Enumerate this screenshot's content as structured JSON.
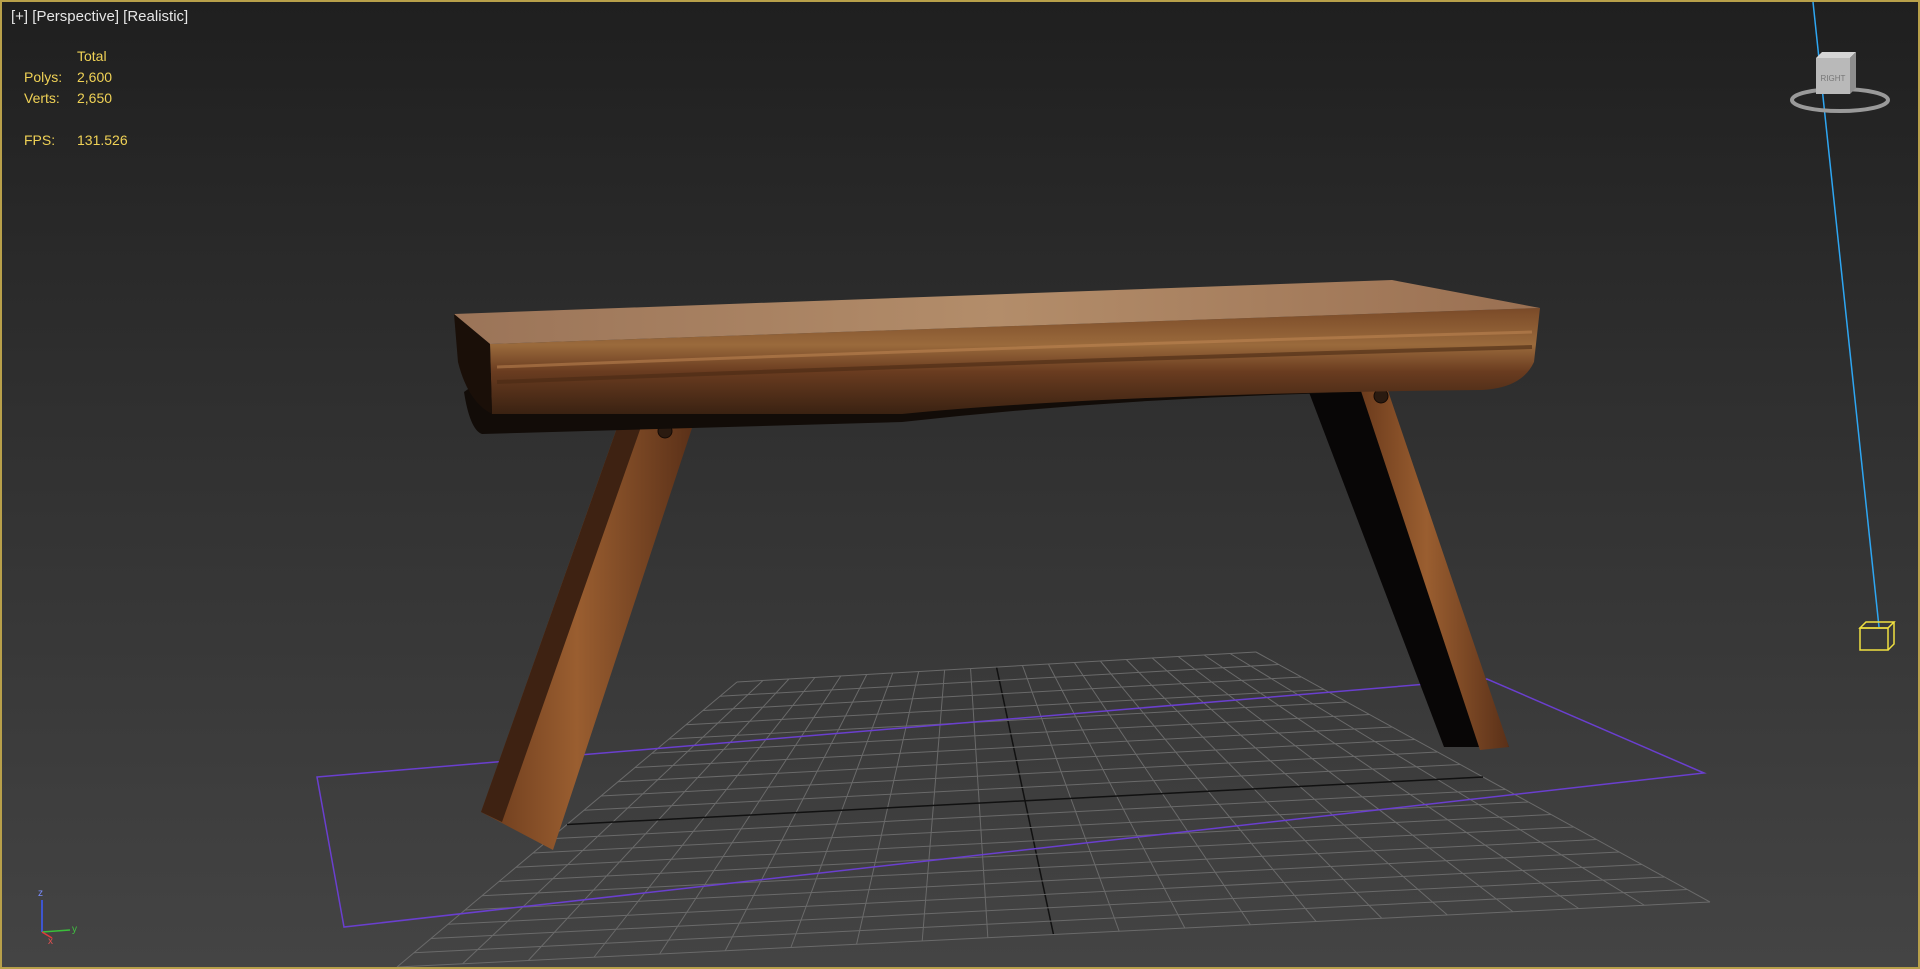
{
  "viewport": {
    "label": {
      "plus": "[+]",
      "view": "[Perspective]",
      "shading": "[Realistic]"
    },
    "stats": {
      "header": "Total",
      "polys_label": "Polys:",
      "polys_value": "2,600",
      "verts_label": "Verts:",
      "verts_value": "2,650",
      "fps_label": "FPS:",
      "fps_value": "131.526"
    },
    "viewcube": {
      "face_text": "RIGHT"
    },
    "axis": {
      "z": "z",
      "x": "x",
      "y": "y"
    }
  },
  "colors": {
    "frame_border": "#b8a04a",
    "stats_text": "#f0d256",
    "selection_box": "#6a3fcf",
    "light_line": "#2ea6f2",
    "light_target": "#f0e040"
  }
}
